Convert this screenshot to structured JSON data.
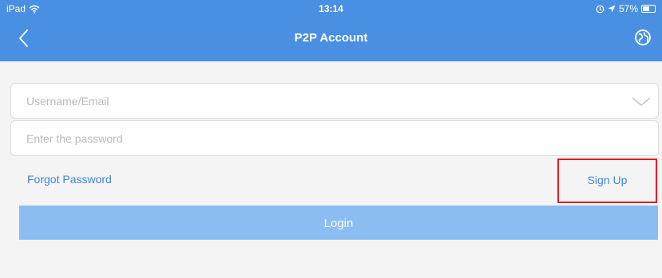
{
  "status_bar": {
    "device": "iPad",
    "time": "13:14",
    "battery": "57%",
    "battery_level": 0.57,
    "icons": [
      "wifi-icon",
      "alarm-icon",
      "location-icon",
      "battery-icon"
    ]
  },
  "header": {
    "title": "P2P Account",
    "background_color": "#4a90e2",
    "icons": [
      "back-chevron-icon",
      "globe-icon"
    ]
  },
  "form": {
    "username_placeholder": "Username/Email",
    "username_value": "",
    "password_placeholder": "Enter the password",
    "password_value": "",
    "dropdown_icon": "chevron-down-icon"
  },
  "links": {
    "forgot_password": "Forgot Password",
    "sign_up": "Sign Up"
  },
  "login": {
    "label": "Login",
    "color": "#8bbdf2"
  },
  "highlight_color": "#e02020"
}
